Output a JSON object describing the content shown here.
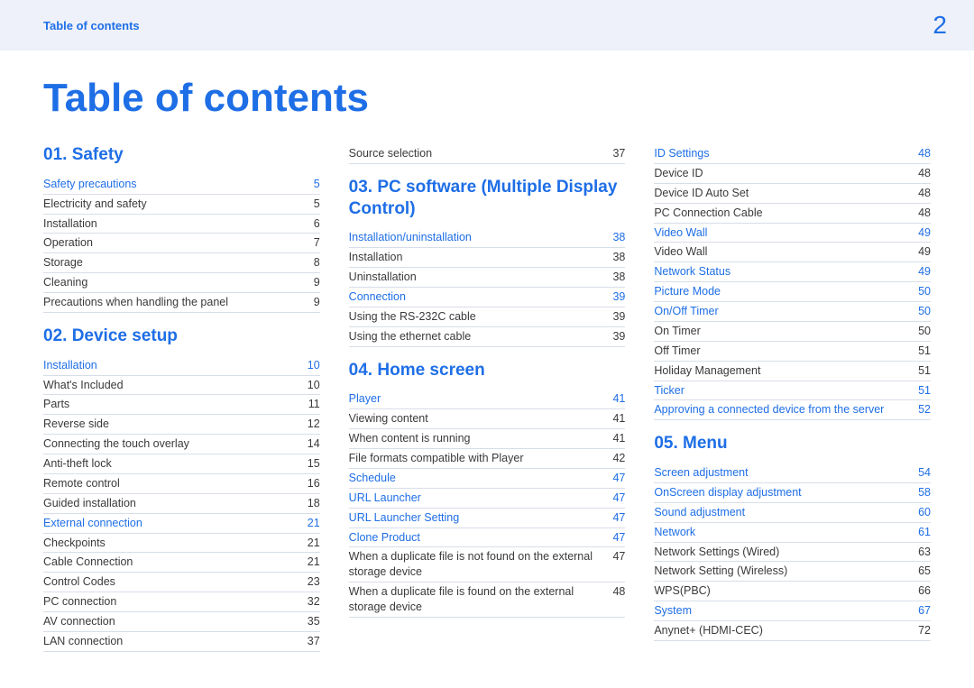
{
  "header": {
    "left": "Table of contents",
    "page": "2"
  },
  "title": "Table of contents",
  "columns": [
    [
      {
        "type": "chapter",
        "text": "01. Safety"
      },
      {
        "type": "section",
        "label": "Safety precautions",
        "pg": "5"
      },
      {
        "type": "item",
        "label": "Electricity and safety",
        "pg": "5"
      },
      {
        "type": "item",
        "label": "Installation",
        "pg": "6"
      },
      {
        "type": "item",
        "label": "Operation",
        "pg": "7"
      },
      {
        "type": "item",
        "label": "Storage",
        "pg": "8"
      },
      {
        "type": "item",
        "label": "Cleaning",
        "pg": "9"
      },
      {
        "type": "item",
        "label": "Precautions when handling the panel",
        "pg": "9"
      },
      {
        "type": "chapter",
        "text": "02. Device setup"
      },
      {
        "type": "section",
        "label": "Installation",
        "pg": "10"
      },
      {
        "type": "item",
        "label": "What's Included",
        "pg": "10"
      },
      {
        "type": "item",
        "label": "Parts",
        "pg": "11"
      },
      {
        "type": "item",
        "label": "Reverse side",
        "pg": "12"
      },
      {
        "type": "item",
        "label": "Connecting the touch overlay",
        "pg": "14"
      },
      {
        "type": "item",
        "label": "Anti-theft lock",
        "pg": "15"
      },
      {
        "type": "item",
        "label": "Remote control",
        "pg": "16"
      },
      {
        "type": "item",
        "label": "Guided installation",
        "pg": "18"
      },
      {
        "type": "section",
        "label": "External connection",
        "pg": "21"
      },
      {
        "type": "item",
        "label": "Checkpoints",
        "pg": "21"
      },
      {
        "type": "item",
        "label": "Cable Connection",
        "pg": "21"
      },
      {
        "type": "item",
        "label": "Control Codes",
        "pg": "23"
      },
      {
        "type": "item",
        "label": "PC connection",
        "pg": "32"
      },
      {
        "type": "item",
        "label": "AV connection",
        "pg": "35"
      },
      {
        "type": "item",
        "label": "LAN connection",
        "pg": "37"
      }
    ],
    [
      {
        "type": "item",
        "label": "Source selection",
        "pg": "37"
      },
      {
        "type": "chapter",
        "text": "03. PC software (Multiple Display Control)"
      },
      {
        "type": "section",
        "label": "Installation/uninstallation",
        "pg": "38"
      },
      {
        "type": "item",
        "label": "Installation",
        "pg": "38"
      },
      {
        "type": "item",
        "label": "Uninstallation",
        "pg": "38"
      },
      {
        "type": "section",
        "label": "Connection",
        "pg": "39"
      },
      {
        "type": "item",
        "label": "Using the RS-232C cable",
        "pg": "39"
      },
      {
        "type": "item",
        "label": "Using the ethernet cable",
        "pg": "39"
      },
      {
        "type": "chapter",
        "text": "04. Home screen"
      },
      {
        "type": "section",
        "label": "Player",
        "pg": "41"
      },
      {
        "type": "item",
        "label": "Viewing content",
        "pg": "41"
      },
      {
        "type": "item",
        "label": "When content is running",
        "pg": "41"
      },
      {
        "type": "item",
        "label": "File formats compatible with Player",
        "pg": "42"
      },
      {
        "type": "section",
        "label": "Schedule",
        "pg": "47"
      },
      {
        "type": "section",
        "label": "URL Launcher",
        "pg": "47"
      },
      {
        "type": "section",
        "label": "URL Launcher Setting",
        "pg": "47"
      },
      {
        "type": "section",
        "label": "Clone Product",
        "pg": "47"
      },
      {
        "type": "item",
        "label": "When a duplicate file is not found on the external storage device",
        "pg": "47"
      },
      {
        "type": "item",
        "label": "When a duplicate file is found on the external storage device",
        "pg": "48"
      }
    ],
    [
      {
        "type": "section",
        "label": "ID Settings",
        "pg": "48"
      },
      {
        "type": "item",
        "label": "Device ID",
        "pg": "48"
      },
      {
        "type": "item",
        "label": "Device ID Auto Set",
        "pg": "48"
      },
      {
        "type": "item",
        "label": "PC Connection Cable",
        "pg": "48"
      },
      {
        "type": "section",
        "label": "Video Wall",
        "pg": "49"
      },
      {
        "type": "item",
        "label": "Video Wall",
        "pg": "49"
      },
      {
        "type": "section",
        "label": "Network Status",
        "pg": "49"
      },
      {
        "type": "section",
        "label": "Picture Mode",
        "pg": "50"
      },
      {
        "type": "section",
        "label": "On/Off Timer",
        "pg": "50"
      },
      {
        "type": "item",
        "label": "On Timer",
        "pg": "50"
      },
      {
        "type": "item",
        "label": "Off Timer",
        "pg": "51"
      },
      {
        "type": "item",
        "label": "Holiday Management",
        "pg": "51"
      },
      {
        "type": "section",
        "label": "Ticker",
        "pg": "51"
      },
      {
        "type": "section",
        "label": "Approving a connected device from the server",
        "pg": "52"
      },
      {
        "type": "chapter",
        "text": "05. Menu"
      },
      {
        "type": "section",
        "label": "Screen adjustment",
        "pg": "54"
      },
      {
        "type": "section",
        "label": "OnScreen display adjustment",
        "pg": "58"
      },
      {
        "type": "section",
        "label": "Sound adjustment",
        "pg": "60"
      },
      {
        "type": "section",
        "label": "Network",
        "pg": "61"
      },
      {
        "type": "item",
        "label": "Network Settings (Wired)",
        "pg": "63"
      },
      {
        "type": "item",
        "label": "Network Setting (Wireless)",
        "pg": "65"
      },
      {
        "type": "item",
        "label": "WPS(PBC)",
        "pg": "66"
      },
      {
        "type": "section",
        "label": "System",
        "pg": "67"
      },
      {
        "type": "item",
        "label": "Anynet+ (HDMI-CEC)",
        "pg": "72"
      }
    ]
  ]
}
